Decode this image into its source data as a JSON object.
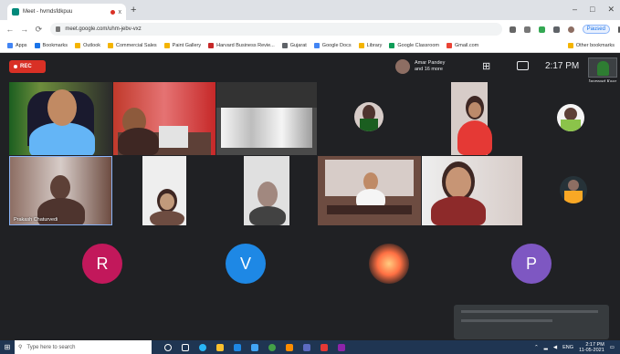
{
  "browser": {
    "tab_title": "Meet - hvmdsfdkpuu",
    "tab_close": "x",
    "new_tab": "+",
    "window_controls": [
      "–",
      "□",
      "✕"
    ],
    "url": "meet.google.com/uhm-jebv-vxz",
    "paused_label": "Paused",
    "bookmarks": [
      "Apps",
      "Bookmarks",
      "Outlook",
      "Commercial Sales",
      "Paint Gallery",
      "Harvard Business Revie...",
      "Gujarat",
      "Google Docs",
      "Library",
      "Google Classroom",
      "Gmail.com"
    ],
    "other_bookmarks": "Other bookmarks"
  },
  "meet": {
    "rec_label": "REC",
    "presenter_name": "Amar Pandey",
    "presenter_sub": "and 16 more",
    "clock": "2:17 PM",
    "self_name": "Jaspreet Kaur",
    "tile_name": "Prakash Chaturvedi",
    "avatars": [
      {
        "letter": "R",
        "color": "#c2185b"
      },
      {
        "letter": "V",
        "color": "#1e88e5"
      },
      {
        "letter": "P",
        "color": "#7e57c2"
      }
    ]
  },
  "taskbar": {
    "search_placeholder": "Type here to search",
    "time": "2:17 PM",
    "date": "11-05-2021",
    "lang": "ENG"
  }
}
